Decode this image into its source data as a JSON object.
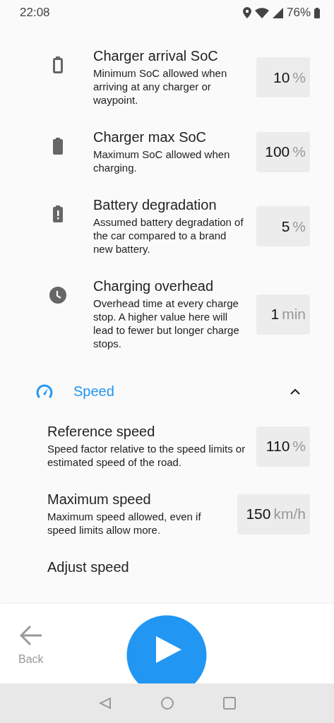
{
  "status_bar": {
    "time": "22:08",
    "battery": "76%"
  },
  "settings": [
    {
      "title": "Charger arrival SoC",
      "description": "Minimum SoC allowed when arriving at any charger or waypoint.",
      "value": "10",
      "unit": "%"
    },
    {
      "title": "Charger max SoC",
      "description": "Maximum SoC allowed when charging.",
      "value": "100",
      "unit": "%"
    },
    {
      "title": "Battery degradation",
      "description": "Assumed battery degradation of the car compared to a brand new battery.",
      "value": "5",
      "unit": "%"
    },
    {
      "title": "Charging overhead",
      "description": "Overhead time at every charge stop. A higher value here will lead to fewer but longer charge stops.",
      "value": "1",
      "unit": "min"
    }
  ],
  "section": {
    "title": "Speed",
    "expanded": true,
    "items": [
      {
        "title": "Reference speed",
        "description": "Speed factor relative to the speed limits or estimated speed of the road.",
        "value": "110",
        "unit": "%"
      },
      {
        "title": "Maximum speed",
        "description": "Maximum speed allowed, even if speed limits allow more.",
        "value": "150",
        "unit": "km/h"
      },
      {
        "title": "Adjust speed"
      }
    ]
  },
  "bottom_bar": {
    "back_label": "Back"
  }
}
